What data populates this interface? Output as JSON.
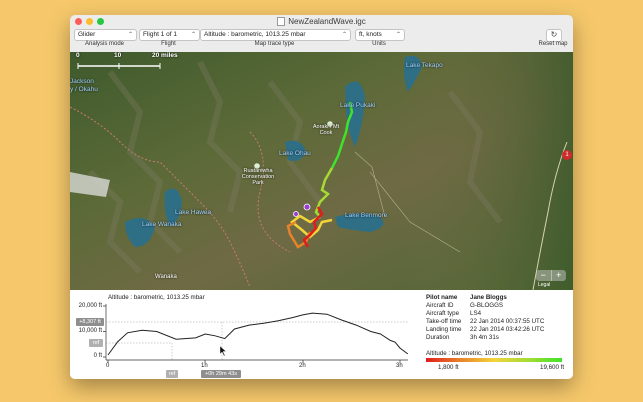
{
  "window": {
    "title": "NewZealandWave.igc"
  },
  "toolbar": {
    "analysis_mode": {
      "value": "Glider",
      "label": "Analysis mode"
    },
    "flight": {
      "value": "Flight 1 of 1",
      "label": "Flight"
    },
    "map_trace": {
      "value": "Altitude : barometric, 1013.25 mbar",
      "label": "Map trace type"
    },
    "units": {
      "value": "ft, knots",
      "label": "Units"
    },
    "reset_label": "Reset map"
  },
  "map": {
    "scale": {
      "t0": "0",
      "t1": "10",
      "t2": "20 miles"
    },
    "places": [
      {
        "name": "Jackson"
      },
      {
        "name": "y / Okahu"
      },
      {
        "name": "Lake Pukaki"
      },
      {
        "name": "Lake Tekapo"
      },
      {
        "name": "Lake Ohau"
      },
      {
        "name": "Lake Hawea"
      },
      {
        "name": "Lake Wanaka"
      },
      {
        "name": "Lake Benmore"
      },
      {
        "name": "Aoraki / Mt Cook"
      },
      {
        "name": "Ruataniwha Conservation Park"
      },
      {
        "name": "Wanaka"
      }
    ],
    "zoom_minus": "−",
    "zoom_plus": "+",
    "road_marker": "1",
    "legal": "Legal"
  },
  "graph": {
    "title": "Altitude : barometric, 1013.25 mbar",
    "y_ticks": [
      "20,000 ft",
      "10,000 ft",
      "0 ft"
    ],
    "x_ticks": [
      "0",
      "1h",
      "2h",
      "3h"
    ],
    "cursor_alt": "+8,307 ft",
    "ref_top": "ref",
    "ref_bottom": "ref",
    "cursor_time": "+0h 29m 43s"
  },
  "pilot": {
    "rows": [
      {
        "label": "Pilot name",
        "value": "Jane Bloggs"
      },
      {
        "label": "Aircraft ID",
        "value": "G-BLOGGS"
      },
      {
        "label": "Aircraft type",
        "value": "LS4"
      },
      {
        "label": "Take-off time",
        "value": "22 Jan 2014 00:37:55 UTC"
      },
      {
        "label": "Landing time",
        "value": "22 Jan 2014 03:42:26 UTC"
      },
      {
        "label": "Duration",
        "value": "3h 4m 31s"
      }
    ],
    "legend_title": "Altitude : barometric, 1013.25 mbar",
    "legend_min": "1,800 ft",
    "legend_max": "19,600 ft"
  },
  "colors": {
    "trace_low": "#e11c1c",
    "trace_high": "#3fe32b",
    "desktop": "#f6c86b"
  },
  "chart_data": {
    "type": "line",
    "title": "Altitude : barometric, 1013.25 mbar",
    "xlabel": "",
    "ylabel": "",
    "xlim": [
      0,
      3.08
    ],
    "ylim": [
      0,
      21000
    ],
    "x": [
      0,
      0.1,
      0.2,
      0.35,
      0.5,
      0.7,
      0.9,
      1.0,
      1.1,
      1.2,
      1.3,
      1.45,
      1.6,
      1.75,
      1.9,
      2.0,
      2.1,
      2.25,
      2.4,
      2.55,
      2.7,
      2.8,
      2.9,
      2.95,
      3.0,
      3.08
    ],
    "series": [
      {
        "values": [
          800,
          6000,
          9500,
          10500,
          10000,
          7000,
          7500,
          9000,
          8300,
          7200,
          11000,
          12500,
          13200,
          14200,
          15500,
          16500,
          17200,
          16800,
          14500,
          12500,
          10000,
          9000,
          6500,
          5800,
          3500,
          1200
        ]
      }
    ]
  }
}
